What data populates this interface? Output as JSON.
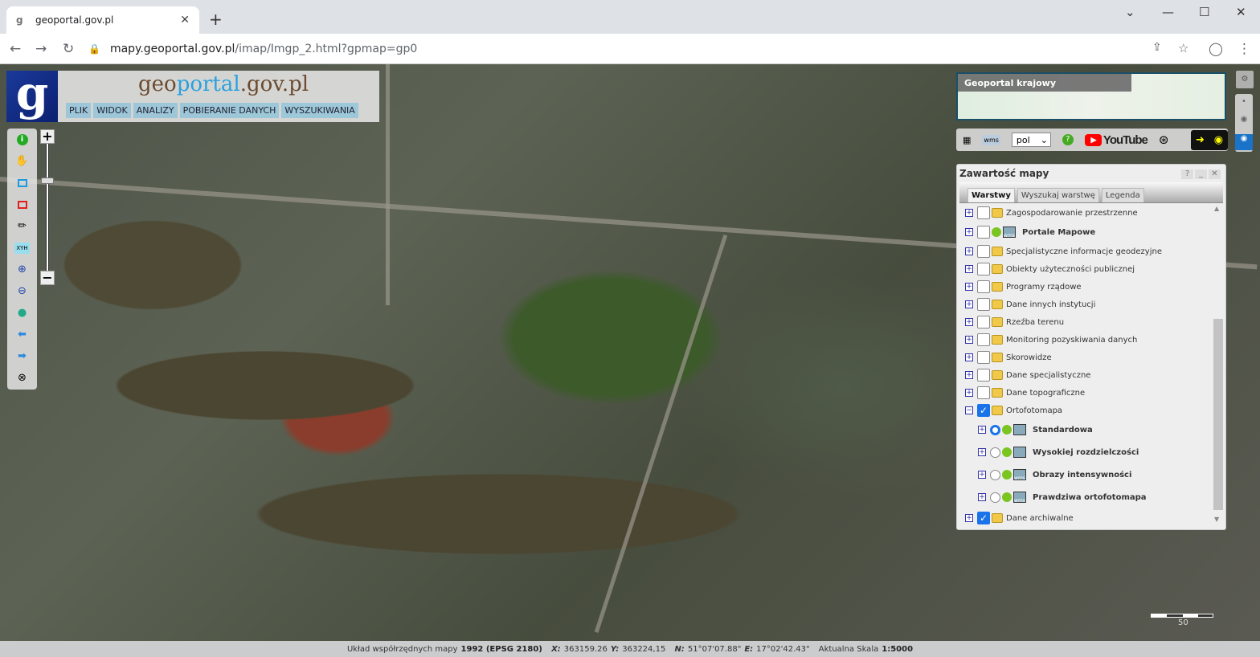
{
  "browser": {
    "tab_title": "geoportal.gov.pl",
    "url_host": "mapy.geoportal.gov.pl",
    "url_path": "/imap/Imgp_2.html?gpmap=gp0"
  },
  "header": {
    "title_g": "g",
    "title_eo": "eo",
    "title_portal": "portal",
    "title_rest": ".gov.pl",
    "menu": [
      "PLIK",
      "WIDOK",
      "ANALIZY",
      "POBIERANIE DANYCH",
      "WYSZUKIWANIA"
    ]
  },
  "toolbar": {
    "xyh_label": "XYH"
  },
  "minimap": {
    "label": "Geoportal krajowy"
  },
  "iconbar": {
    "language": "pol",
    "youtube": "YouTube"
  },
  "panel": {
    "title": "Zawartość mapy",
    "tabs": [
      "Warstwy",
      "Wyszukaj warstwę",
      "Legenda"
    ],
    "layers": [
      {
        "label": "Zagospodarowanie przestrzenne",
        "checked": false
      },
      {
        "label": "Portale Mapowe",
        "checked": false
      },
      {
        "label": "Specjalistyczne informacje geodezyjne",
        "checked": false
      },
      {
        "label": "Obiekty użyteczności publicznej",
        "checked": false
      },
      {
        "label": "Programy rządowe",
        "checked": false
      },
      {
        "label": "Dane innych instytucji",
        "checked": false
      },
      {
        "label": "Rzeźba terenu",
        "checked": false
      },
      {
        "label": "Monitoring pozyskiwania danych",
        "checked": false
      },
      {
        "label": "Skorowidze",
        "checked": false
      },
      {
        "label": "Dane specjalistyczne",
        "checked": false
      },
      {
        "label": "Dane topograficzne",
        "checked": false
      },
      {
        "label": "Ortofotomapa",
        "checked": true
      },
      {
        "label": "Dane archiwalne",
        "checked": true
      }
    ],
    "sublayers": [
      {
        "label": "Standardowa",
        "selected": true
      },
      {
        "label": "Wysokiej rozdzielczości",
        "selected": false
      },
      {
        "label": "Obrazy intensywności",
        "selected": false
      },
      {
        "label": "Prawdziwa ortofotomapa",
        "selected": false
      }
    ]
  },
  "scale_bar": {
    "label": "50"
  },
  "status": {
    "system_label": "Układ współrzędnych mapy",
    "system": "1992 (EPSG 2180)",
    "x_label": "X:",
    "x": "363159.26",
    "y_label": "Y:",
    "y": "363224,15",
    "n_label": "N:",
    "n": "51°07'07.88\"",
    "e_label": "E:",
    "e": "17°02'42.43\"",
    "scale_label": "Aktualna Skala",
    "scale": "1:5000"
  }
}
